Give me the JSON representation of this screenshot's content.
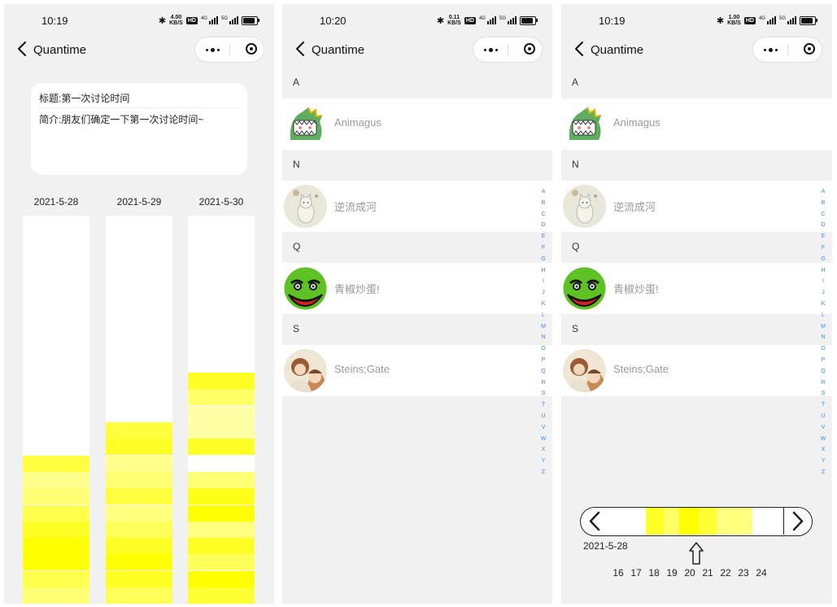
{
  "status_bars": [
    {
      "time": "10:19",
      "speed_top": "4.00",
      "speed_unit": "KB/S"
    },
    {
      "time": "10:20",
      "speed_top": "0.11",
      "speed_unit": "KB/S"
    },
    {
      "time": "10:19",
      "speed_top": "1.00",
      "speed_unit": "KB/S"
    }
  ],
  "status_icons": {
    "bluetooth": "bluetooth-icon",
    "hd": "HD",
    "signal_1": "4G",
    "signal_2": "5G",
    "battery": "battery-icon"
  },
  "nav": {
    "title": "Quantime"
  },
  "topic": {
    "title_line": "标题:第一次讨论时间",
    "intro_line": "简介:朋友们确定一下第一次讨论时间~"
  },
  "availability": {
    "dates": [
      "2021-5-28",
      "2021-5-29",
      "2021-5-30"
    ],
    "colors": {
      "empty": "#ffffff",
      "brightest": "#ffff00"
    }
  },
  "contacts": {
    "sections": [
      {
        "letter": "A",
        "name": "Animagus",
        "avatar": "dinosaur-avatar"
      },
      {
        "letter": "N",
        "name": "逆流成河",
        "avatar": "cat-avatar"
      },
      {
        "letter": "Q",
        "name": "青椒炒蛋!",
        "avatar": "green-face-avatar"
      },
      {
        "letter": "S",
        "name": "Steins;Gate",
        "avatar": "anime-avatar"
      }
    ],
    "index_letters": [
      "A",
      "B",
      "C",
      "D",
      "E",
      "F",
      "G",
      "H",
      "I",
      "J",
      "K",
      "L",
      "M",
      "N",
      "O",
      "P",
      "Q",
      "R",
      "S",
      "T",
      "U",
      "V",
      "W",
      "X",
      "Y",
      "Z"
    ]
  },
  "time_slider": {
    "date": "2021-5-28",
    "hours": [
      "16",
      "17",
      "18",
      "19",
      "20",
      "21",
      "22",
      "23",
      "24"
    ]
  }
}
